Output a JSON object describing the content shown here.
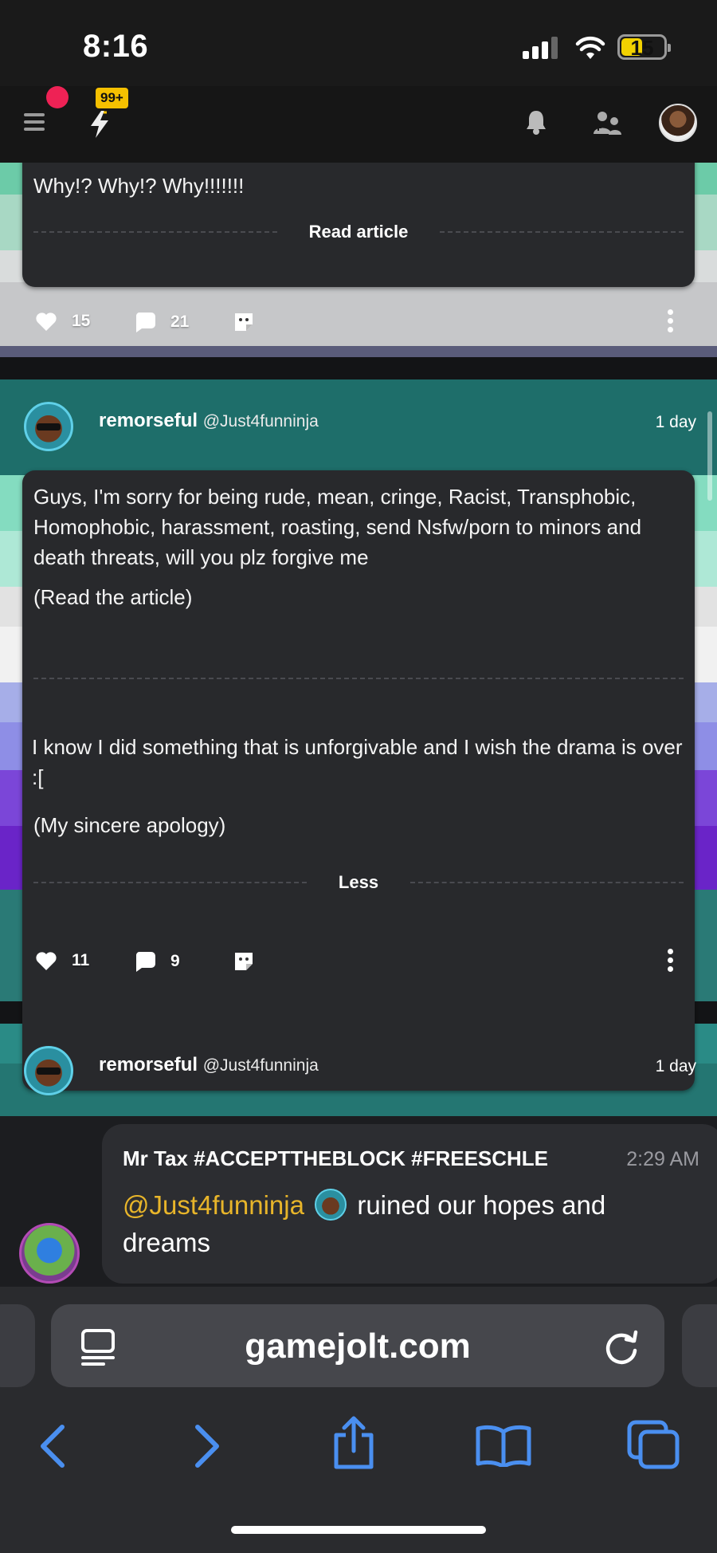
{
  "status": {
    "time": "8:16",
    "battery": "15"
  },
  "header": {
    "notif_badge": "99+"
  },
  "posts": [
    {
      "lead_text": "Why!? Why!? Why!!!!!!!",
      "read_more_label": "Read article",
      "likes": "15",
      "comments": "21"
    },
    {
      "author_name": "remorseful",
      "author_handle": "@Just4funninja",
      "age": "1 day",
      "lead_text": "Guys, I'm sorry for being rude, mean, cringe, Racist, Transphobic, Homophobic, harassment, roasting, send Nsfw/porn to minors and death threats, will you plz forgive me",
      "sub_text": "(Read the article)",
      "article_text": "I know I did something that is unforgivable and I wish the drama is over :[",
      "article_sub": "(My sincere apology)",
      "less_label": "Less",
      "likes": "11",
      "comments": "9"
    },
    {
      "author_name": "remorseful",
      "author_handle": "@Just4funninja",
      "age": "1 day"
    }
  ],
  "notification": {
    "sender": "Mr Tax #ACCEPTTHEBLOCK #FREESCHLE",
    "time": "2:29 AM",
    "mention": "@Just4funninja",
    "message": "ruined our hopes and dreams"
  },
  "browser": {
    "url": "gamejolt.com"
  },
  "icons": [
    "menu-icon",
    "bolt-icon",
    "bell-icon",
    "friends-icon",
    "heart-icon",
    "comment-icon",
    "sticker-icon",
    "more-icon",
    "reader-icon",
    "reload-icon",
    "back-icon",
    "forward-icon",
    "share-icon",
    "bookmarks-icon",
    "tabs-icon"
  ]
}
